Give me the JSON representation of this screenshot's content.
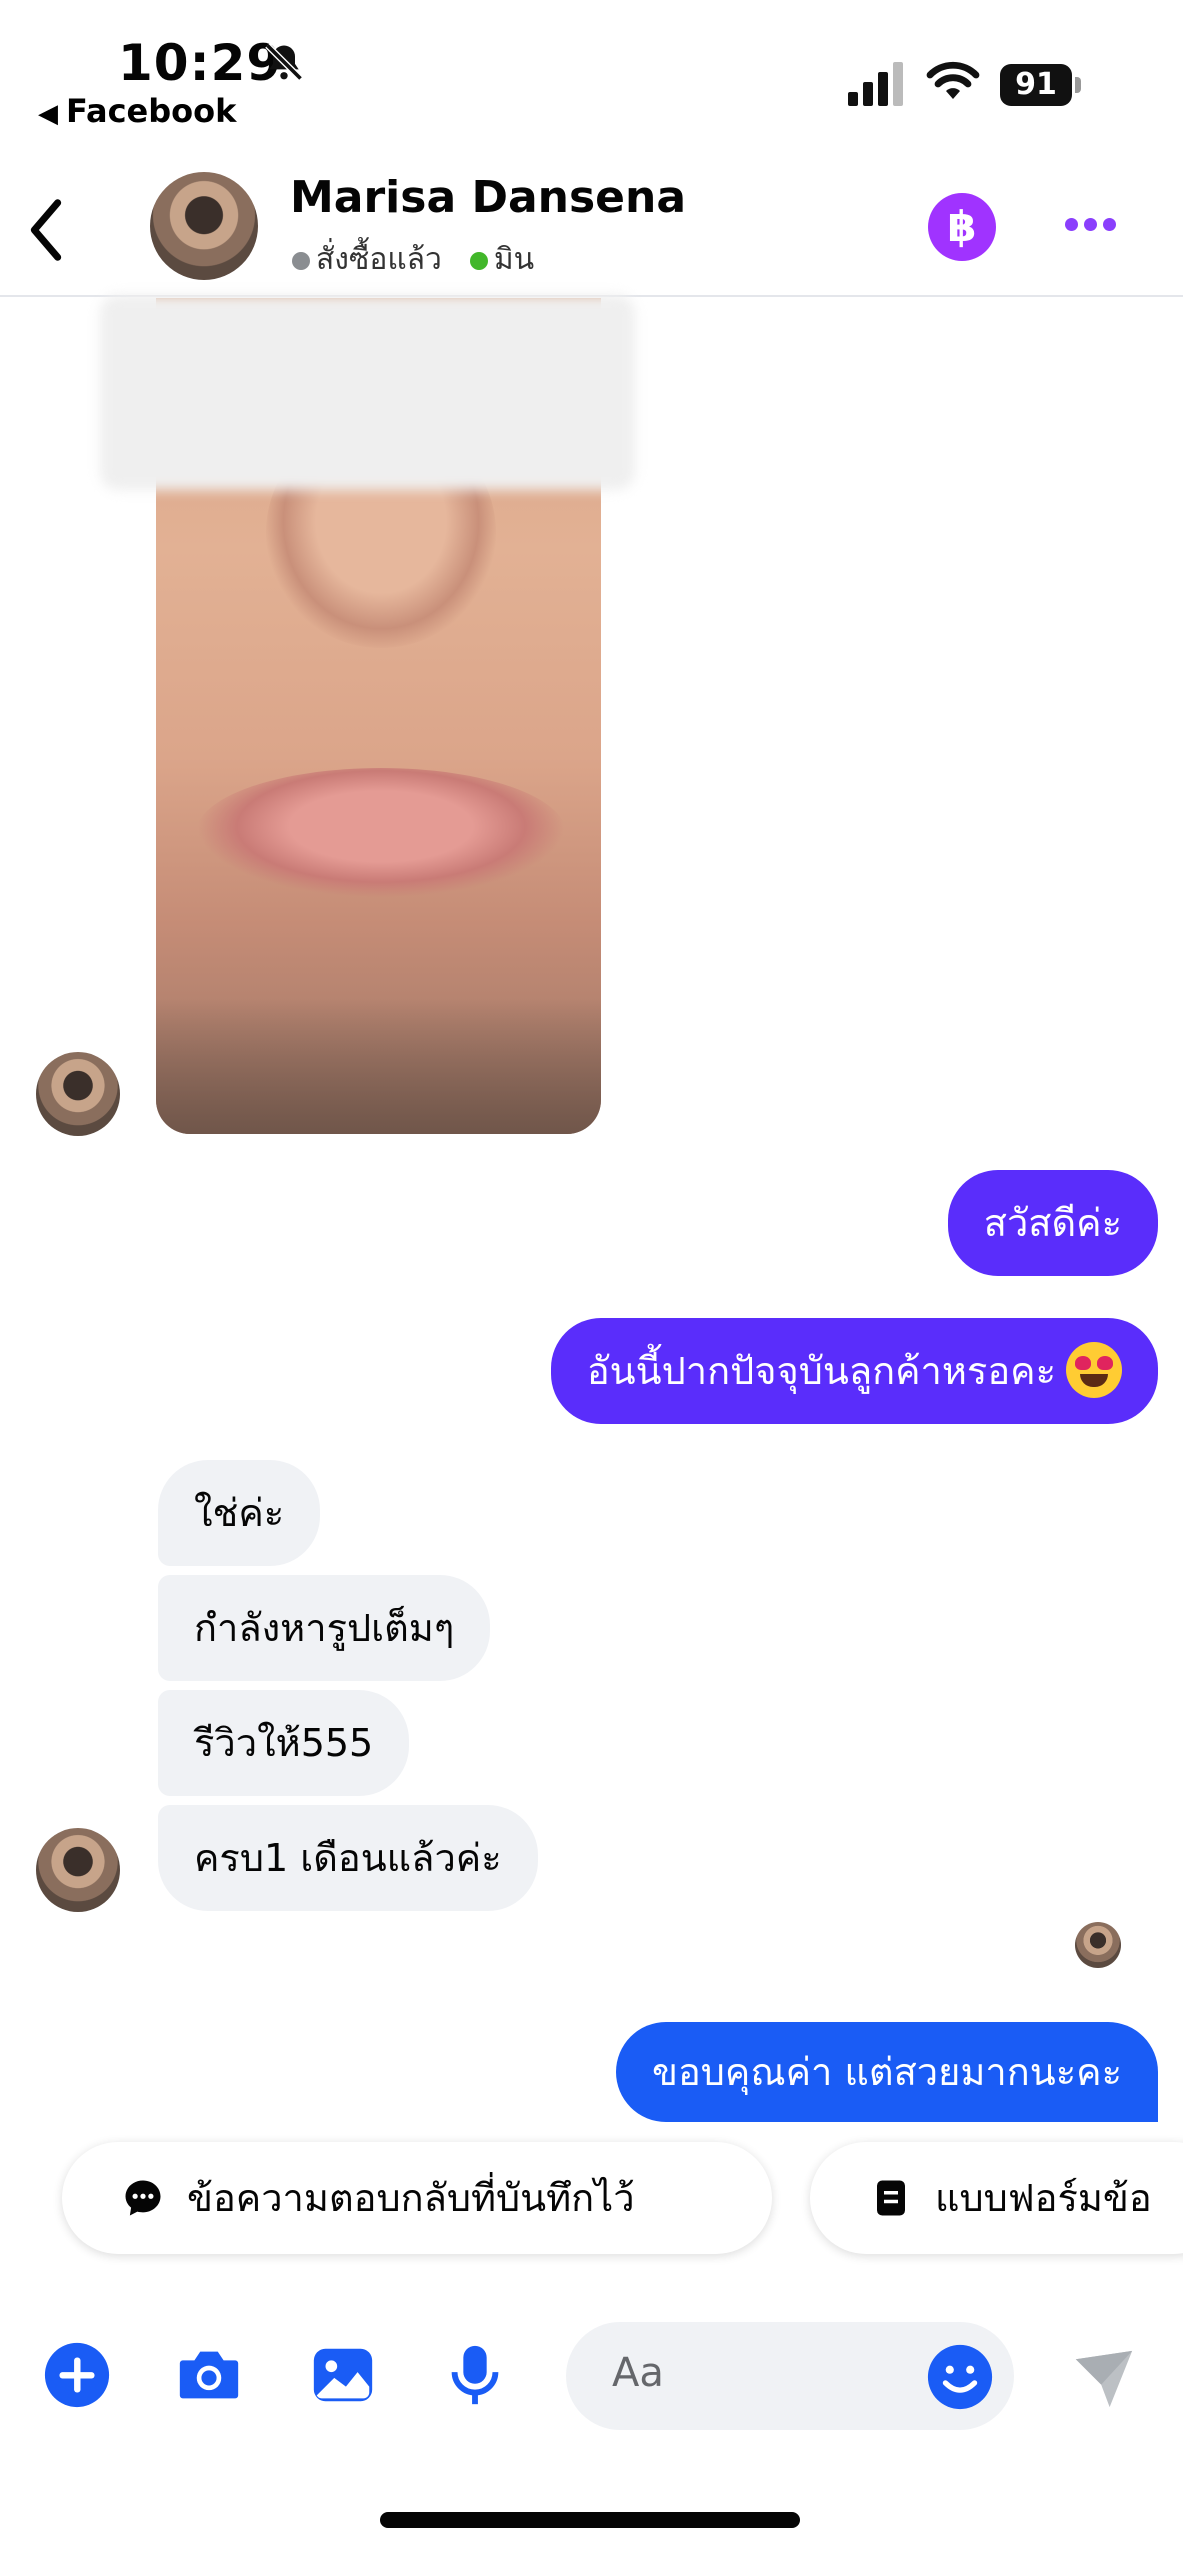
{
  "status_bar": {
    "time": "10:29",
    "back_app": "Facebook",
    "battery": "91",
    "icons": [
      "bell-slash-icon",
      "signal-icon",
      "wifi-icon",
      "battery-icon"
    ]
  },
  "header": {
    "contact_name": "Marisa Dansena",
    "tag_1": "สั่งซื้อแล้ว",
    "tag_2": "มิน",
    "baht_label": "฿",
    "colors": {
      "accent": "#8a3ffc",
      "baht_button": "#a033ff",
      "tag_online": "#42b72a"
    }
  },
  "messages": {
    "out_1": "สวัสดีค่ะ",
    "out_2": "อันนี้ปากปัจจุบันลูกค้าหรอคะ",
    "in_1": "ใช่ค่ะ",
    "in_2": "กำลังหารูปเต็มๆ",
    "in_3": "รีวิวให้555",
    "in_4": "ครบ1 เดือนแล้วค่ะ",
    "out_3": "ขอบคุณค่า แต่สวยมากนะคะ",
    "colors": {
      "outgoing_purple": "#5a2dfb",
      "outgoing_blue": "#1a5cf5",
      "incoming": "#f0f2f5"
    }
  },
  "quick_replies": {
    "chip_1": "ข้อความตอบกลับที่บันทึกไว้",
    "chip_2": "แบบฟอร์มข้อ"
  },
  "composer": {
    "placeholder": "Aa",
    "icons": [
      "plus-icon",
      "camera-icon",
      "image-icon",
      "microphone-icon",
      "smiley-icon",
      "send-icon"
    ]
  }
}
